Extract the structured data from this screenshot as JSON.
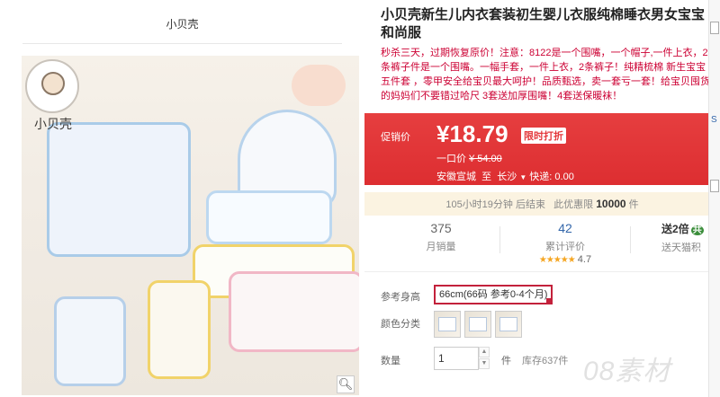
{
  "shop": {
    "name": "小贝壳",
    "logo_text": "小贝壳"
  },
  "product": {
    "title_line1": "小贝壳新生儿内衣套装初生婴儿衣服纯棉睡衣男女宝宝",
    "title_line2": "和尚服",
    "description": "秒杀三天，过期恢复原价！注意：8122是一个围嘴，一个帽子,一件上衣，2条裤子件是一个围嘴。一幅手套，一件上衣，2条裤子！纯精梳棉 新生宝宝五件套 ，零甲安全给宝贝最大呵护！品质甄选，卖一套亏一套！给宝贝囤货的妈妈们不要错过哈尺 3套送加厚围嘴！4套送保暖袜！"
  },
  "price": {
    "label": "促销价",
    "value": "¥18.79",
    "tag": "限时打折",
    "original_label": "一口价",
    "original_value": "¥ 54.00",
    "ship_from": "安徽宣城",
    "ship_to_prefix": "至",
    "ship_to": "长沙",
    "ship_fee": "快递: 0.00"
  },
  "countdown": {
    "time_text": "105小时19分钟",
    "end_text": "后结束",
    "limit_text": "此优惠限",
    "limit_count": "10000",
    "unit": "件"
  },
  "stats": {
    "sales": {
      "value": "375",
      "label": "月销量"
    },
    "reviews": {
      "value": "42",
      "label": "累计评价",
      "stars": "★★★★★",
      "rating": "4.7"
    },
    "points": {
      "value": "送2倍",
      "badge": "共",
      "label": "送天猫积"
    }
  },
  "options": {
    "size_label": "参考身高",
    "size_selected": "66cm(66码 参考0-4个月)",
    "color_label": "颜色分类",
    "qty_label": "数量",
    "qty_value": "1",
    "qty_unit": "件",
    "stock": "库存637件"
  },
  "icons": {
    "zoom": "search-icon",
    "up": "arrow-up-icon",
    "down": "arrow-down-icon"
  },
  "watermark": "08素材",
  "edge_letter": "S"
}
